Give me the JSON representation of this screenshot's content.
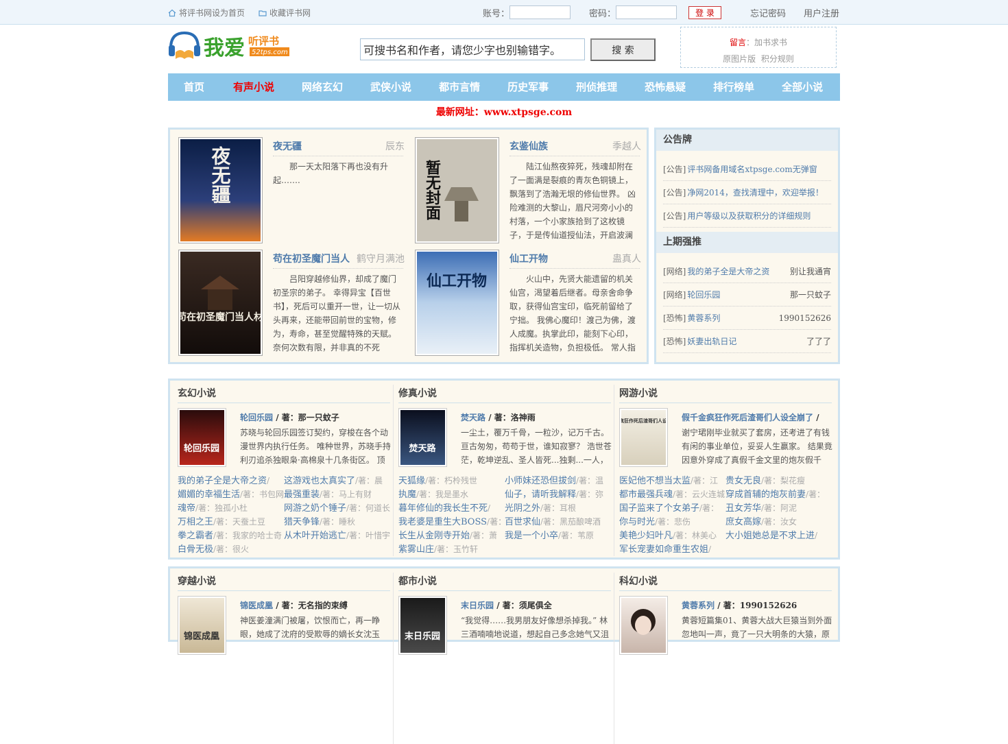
{
  "topbar": {
    "set_home": "将评书网设为首页",
    "bookmark": "收藏评书网",
    "account_label": "账号：",
    "password_label": "密码：",
    "login_button": "登 录",
    "forgot_password": "忘记密码",
    "register": "用户注册"
  },
  "header": {
    "logo_text": "我爱听评书",
    "logo_sub": "52tps.com",
    "search_placeholder": "可搜书名和作者，请您少字也别输错字。",
    "search_button": "搜 索",
    "note_label": "留言",
    "note_text": "：加书求书",
    "note_links": [
      "原图片版",
      "积分规则"
    ]
  },
  "nav": [
    {
      "label": "首页",
      "active": false
    },
    {
      "label": "有声小说",
      "active": true
    },
    {
      "label": "网络玄幻",
      "active": false
    },
    {
      "label": "武侠小说",
      "active": false
    },
    {
      "label": "都市言情",
      "active": false
    },
    {
      "label": "历史军事",
      "active": false
    },
    {
      "label": "刑侦推理",
      "active": false
    },
    {
      "label": "恐怖悬疑",
      "active": false
    },
    {
      "label": "排行榜单",
      "active": false
    },
    {
      "label": "全部小说",
      "active": false
    }
  ],
  "newurl": "最新网址：www.xtpsge.com",
  "featured": [
    {
      "title": "夜无疆",
      "author": "辰东",
      "cover_text": "夜无疆",
      "desc": "那一天太阳落下再也没有升起……."
    },
    {
      "title": "玄鉴仙族",
      "author": "季越人",
      "cover_text": "暂无封面",
      "desc": "陆江仙熬夜猝死，残魂却附在了一面满是裂痕的青灰色铜镜上，飘落到了浩瀚无垠的修仙世界。 凶险难测的大黎山，眉尺河旁小小的村落，一个小家族拾到了这枚镜子，于是传仙道授仙法，开启波澜"
    },
    {
      "title": "苟在初圣魔门当人",
      "author": "鹤守月满池",
      "cover_text": "苟在初圣魔门当人材",
      "desc": "吕阳穿越修仙界，却成了魔门初圣宗的弟子。 幸得异宝【百世书】，死后可以重开一世，让一切从头再来，还能带回前世的宝物，修为，寿命，甚至觉醒特殊的天赋。 奈何次数有限，并非真的不死"
    },
    {
      "title": "仙工开物",
      "author": "蛊真人",
      "cover_text": "仙工开物",
      "desc": "火山中，先贤大能遗留的机关仙宫，渴望着后继者。母亲舍命争取，获得仙宫宝印，临死前留给了宁拙。 我佛心魔印！渡己为佛，渡人成魔。执掌此印，能刻下心印，指挥机关造物，负担极低。 常人指"
    }
  ],
  "notice": {
    "title": "公告牌",
    "items": [
      {
        "tag": "[公告]",
        "text": "评书网备用域名xtpsge.com无弹窗"
      },
      {
        "tag": "[公告]",
        "text": "净网2014，查找清理中，欢迎举报！"
      },
      {
        "tag": "[公告]",
        "text": "用户等级以及获取积分的详细规则"
      }
    ]
  },
  "recommend": {
    "title": "上期强推",
    "items": [
      {
        "tag": "[网络]",
        "text": "我的弟子全是大帝之资",
        "author": "别让我通宵"
      },
      {
        "tag": "[网络]",
        "text": "轮回乐园",
        "author": "那一只蚊子"
      },
      {
        "tag": "[恐怖]",
        "text": "黄蓉系列",
        "author": "1990152626"
      },
      {
        "tag": "[恐怖]",
        "text": "妖妻出轨日记",
        "author": "了了了"
      }
    ]
  },
  "sections": [
    {
      "title": "玄幻小说",
      "book": "轮回乐园",
      "author_prefix": " / 著：",
      "author": "那一只蚊子",
      "cover_text": "轮回乐园",
      "desc": "苏晓与轮回乐园签订契约，穿梭在各个动漫世界内执行任务。 唯种世界，苏晓手持利刃追杀独眼枭·高棉泉十几条街区。 顶",
      "links": [
        {
          "name": "我的弟子全是大帝之资",
          "meta": "/"
        },
        {
          "name": "这游戏也太真实了",
          "meta": "/著：晨"
        },
        {
          "name": "媚媚的幸福生活",
          "meta": "/著：书包网"
        },
        {
          "name": "最强重装",
          "meta": "/著：马上有财"
        },
        {
          "name": "魂帝",
          "meta": "/著：独孤小杜"
        },
        {
          "name": "网游之奶个锤子",
          "meta": "/著：何道长"
        },
        {
          "name": "万相之王",
          "meta": "/著：天蚕土豆"
        },
        {
          "name": "猎天争锋",
          "meta": "/著：睡秋"
        },
        {
          "name": "拳之霸者",
          "meta": "/著：我家的哈士奇"
        },
        {
          "name": "从木叶开始逃亡",
          "meta": "/著：叶惜宇"
        },
        {
          "name": "白骨无极",
          "meta": "/著：很火"
        }
      ]
    },
    {
      "title": "修真小说",
      "book": "焚天路",
      "author_prefix": " / 著：",
      "author": "洛神雨",
      "cover_text": "焚天路",
      "desc": "一尘土，覆万千骨，一粒沙，记万千古。亘古匆匆，苟苟于世，谁知寂寥？ 浩世苍茫，乾坤逆乱、圣人皆死...独剩...一人，",
      "links": [
        {
          "name": "天狐缘",
          "meta": "/著：朽柃残世"
        },
        {
          "name": "小师妹还恐但拔剑",
          "meta": "/著：温"
        },
        {
          "name": "执魔",
          "meta": "/著：我是墨水"
        },
        {
          "name": "仙子，请听我解释",
          "meta": "/著：弥"
        },
        {
          "name": "暮年修仙的我长生不死",
          "meta": "/"
        },
        {
          "name": "光阴之外",
          "meta": "/著：耳根"
        },
        {
          "name": "我老婆是重生大BOSS",
          "meta": "/著："
        },
        {
          "name": "百世求仙",
          "meta": "/著：黑茄酿啤酒"
        },
        {
          "name": "长生从金刚寺开始",
          "meta": "/著：萧"
        },
        {
          "name": "我是一个小卒",
          "meta": "/著：苇原"
        },
        {
          "name": "紫雾山庄",
          "meta": "/著：玉竹轩"
        }
      ]
    },
    {
      "title": "网游小说",
      "book": "假千金疯狂作死后渣哥们人设全崩了",
      "author_prefix": " /",
      "author": "",
      "cover_text": "假千金疯狂作死后渣哥们人设全崩了",
      "desc": "谢宁珺刚毕业就买了套房，还考进了有钱有闲的事业单位，妥妥人生赢家。 结果竟因意外穿成了真假千金文里的炮灰假千",
      "links": [
        {
          "name": "医妃他不想当太监",
          "meta": "/著：江"
        },
        {
          "name": "贵女无良",
          "meta": "/著：梨花瘦"
        },
        {
          "name": "都市最强兵魂",
          "meta": "/著：云火连城"
        },
        {
          "name": "穿成首辅的炮灰前妻",
          "meta": "/著："
        },
        {
          "name": "国子监来了个女弟子",
          "meta": "/著："
        },
        {
          "name": "丑女芳华",
          "meta": "/著：阿泥"
        },
        {
          "name": "你与时光",
          "meta": "/著：悲伤"
        },
        {
          "name": "庶女高嫁",
          "meta": "/著：汝女"
        },
        {
          "name": "美艳少妇叶凡",
          "meta": "/著：林美心"
        },
        {
          "name": "大小姐她总是不求上进",
          "meta": "/"
        },
        {
          "name": "军长宠妻如命重生农姐",
          "meta": "/"
        }
      ]
    },
    {
      "title": "穿越小说",
      "book": "锦医成凰",
      "author_prefix": " / 著：",
      "author": "无名指的束缚",
      "cover_text": "锦医成凰",
      "desc": "神医姜潼满门被屠，饮恨而亡，再一睁眼，她成了沈府的受欺辱的嫡长女沈玉",
      "links": []
    },
    {
      "title": "都市小说",
      "book": "末日乐园",
      "author_prefix": " / 著：",
      "author": "须尾俱全",
      "cover_text": "末日乐园",
      "desc": "“我觉得……我男朋友好像想杀掉我。” 林三酒喃喃地说道，想起自己多念她气又沮",
      "links": []
    },
    {
      "title": "科幻小说",
      "book": "黄蓉系列",
      "author_prefix": " / 著：",
      "author": "1990152626",
      "cover_text": "",
      "desc": "黄蓉短篇集01、黄蓉大战大巨猿当到外面忽地叫一声，竟了一只大明条的大猿，原",
      "links": []
    }
  ],
  "colors": {
    "nav_bg": "#8cc6e9",
    "link": "#4f7bab",
    "accent_red": "#e00000",
    "box_border": "#cfe3f0",
    "box_bg": "#fcf8ee"
  }
}
